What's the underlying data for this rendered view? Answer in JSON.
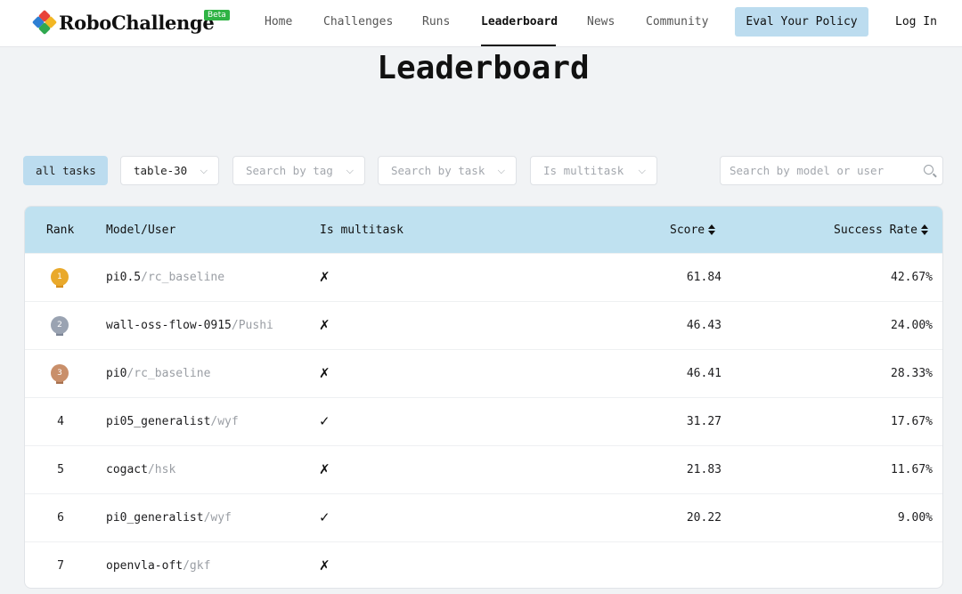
{
  "brand": {
    "name": "RoboChallenge",
    "badge": "Beta"
  },
  "nav": {
    "items": [
      "Home",
      "Challenges",
      "Runs",
      "Leaderboard",
      "News",
      "Community"
    ],
    "active": "Leaderboard",
    "cta": "Eval Your Policy",
    "login": "Log In"
  },
  "page": {
    "title": "Leaderboard"
  },
  "filters": {
    "all_tasks": "all tasks",
    "table": "table-30",
    "tag_placeholder": "Search by tag",
    "task_placeholder": "Search by task",
    "multitask_placeholder": "Is multitask",
    "search_placeholder": "Search by model or user"
  },
  "table": {
    "headers": {
      "rank": "Rank",
      "model": "Model/User",
      "multitask": "Is multitask",
      "score": "Score",
      "success_rate": "Success Rate"
    },
    "rows": [
      {
        "rank": "1",
        "model": "pi0.5",
        "user": "/rc_baseline",
        "multitask": "✗",
        "score": "61.84",
        "success_rate": "42.67%"
      },
      {
        "rank": "2",
        "model": "wall-oss-flow-0915",
        "user": "/Pushi",
        "multitask": "✗",
        "score": "46.43",
        "success_rate": "24.00%"
      },
      {
        "rank": "3",
        "model": "pi0",
        "user": "/rc_baseline",
        "multitask": "✗",
        "score": "46.41",
        "success_rate": "28.33%"
      },
      {
        "rank": "4",
        "model": "pi05_generalist",
        "user": "/wyf",
        "multitask": "✓",
        "score": "31.27",
        "success_rate": "17.67%"
      },
      {
        "rank": "5",
        "model": "cogact",
        "user": "/hsk",
        "multitask": "✗",
        "score": "21.83",
        "success_rate": "11.67%"
      },
      {
        "rank": "6",
        "model": "pi0_generalist",
        "user": "/wyf",
        "multitask": "✓",
        "score": "20.22",
        "success_rate": "9.00%"
      },
      {
        "rank": "7",
        "model": "openvla-oft",
        "user": "/gkf",
        "multitask": "✗",
        "score": "",
        "success_rate": ""
      }
    ]
  },
  "colors": {
    "accent": "#bcdcef",
    "gold": "#e9a92b",
    "silver": "#9aa3b2",
    "bronze": "#c98f6a",
    "beta": "#2fb344"
  }
}
